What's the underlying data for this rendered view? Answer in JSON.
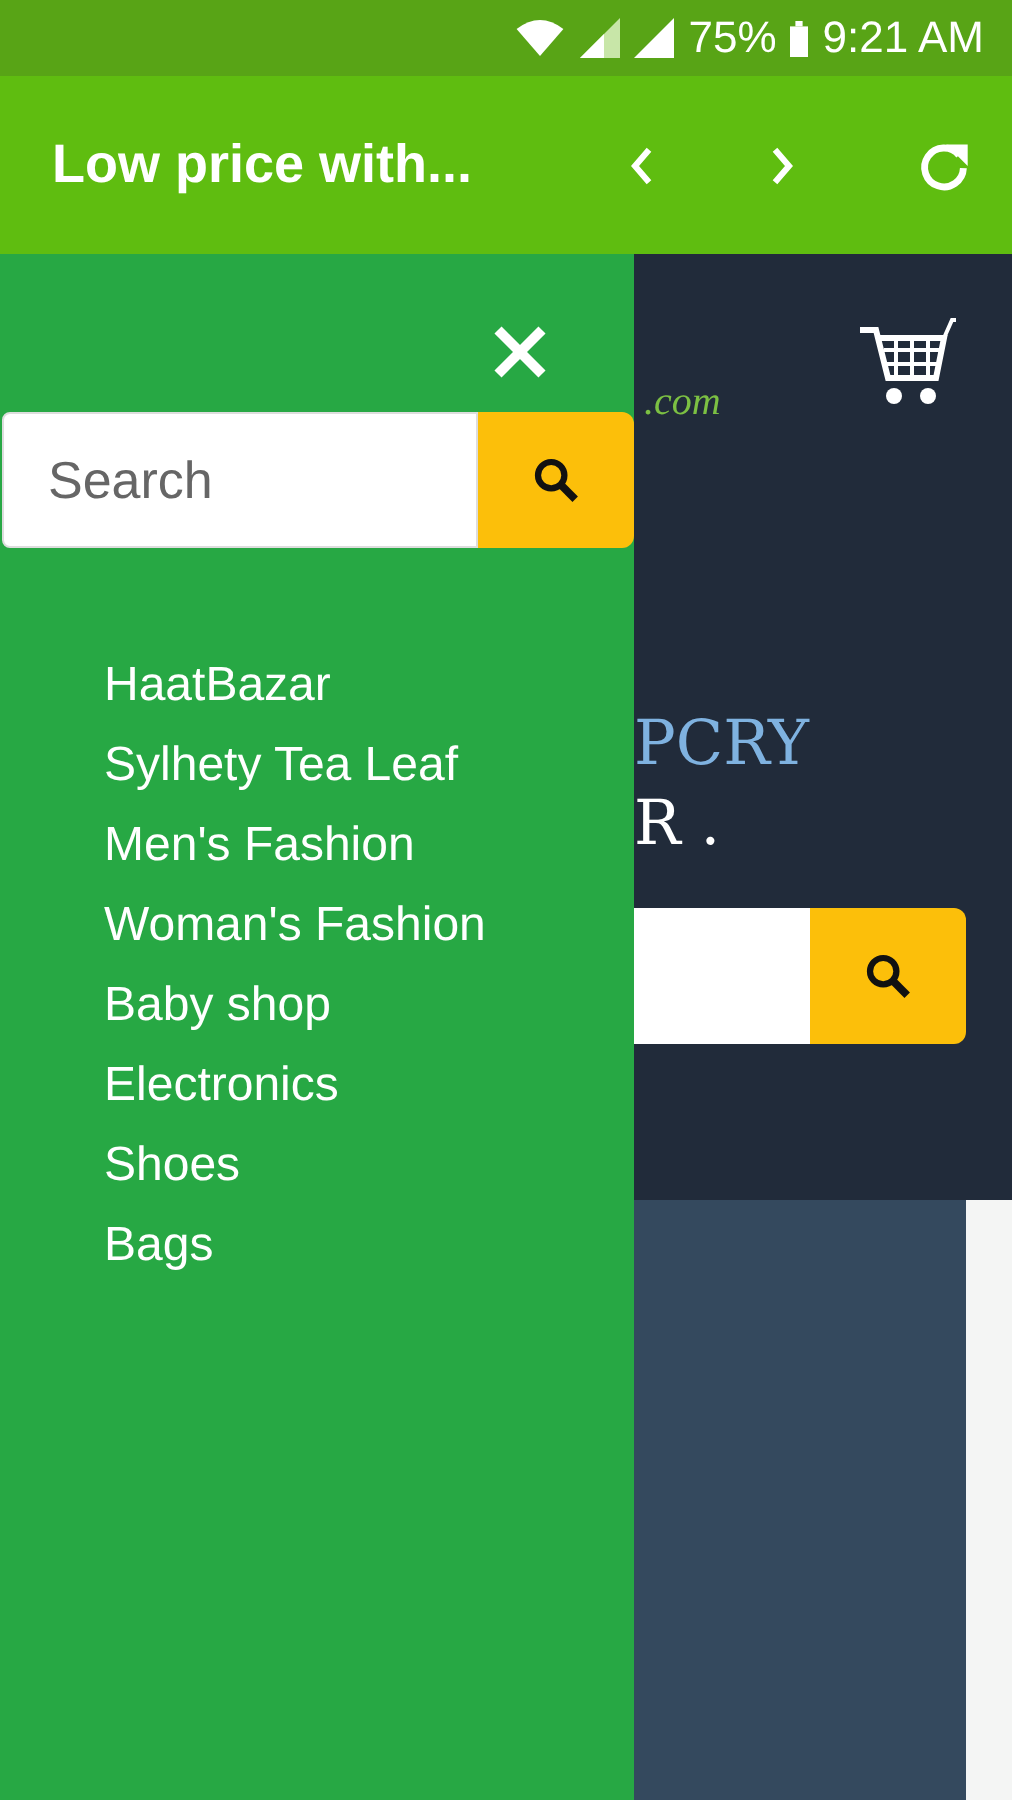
{
  "status_bar": {
    "battery": "75%",
    "time": "9:21 AM"
  },
  "toolbar": {
    "title": "Low price with..."
  },
  "drawer": {
    "search": {
      "placeholder": "Search"
    },
    "items": [
      {
        "label": "HaatBazar"
      },
      {
        "label": "Sylhety Tea Leaf"
      },
      {
        "label": "Men's Fashion"
      },
      {
        "label": "Woman's Fashion"
      },
      {
        "label": "Baby shop"
      },
      {
        "label": "Electronics"
      },
      {
        "label": "Shoes"
      },
      {
        "label": "Bags"
      }
    ]
  },
  "page": {
    "logo_suffix": ".com",
    "heading_1": "PCRY",
    "heading_2": "R ."
  }
}
